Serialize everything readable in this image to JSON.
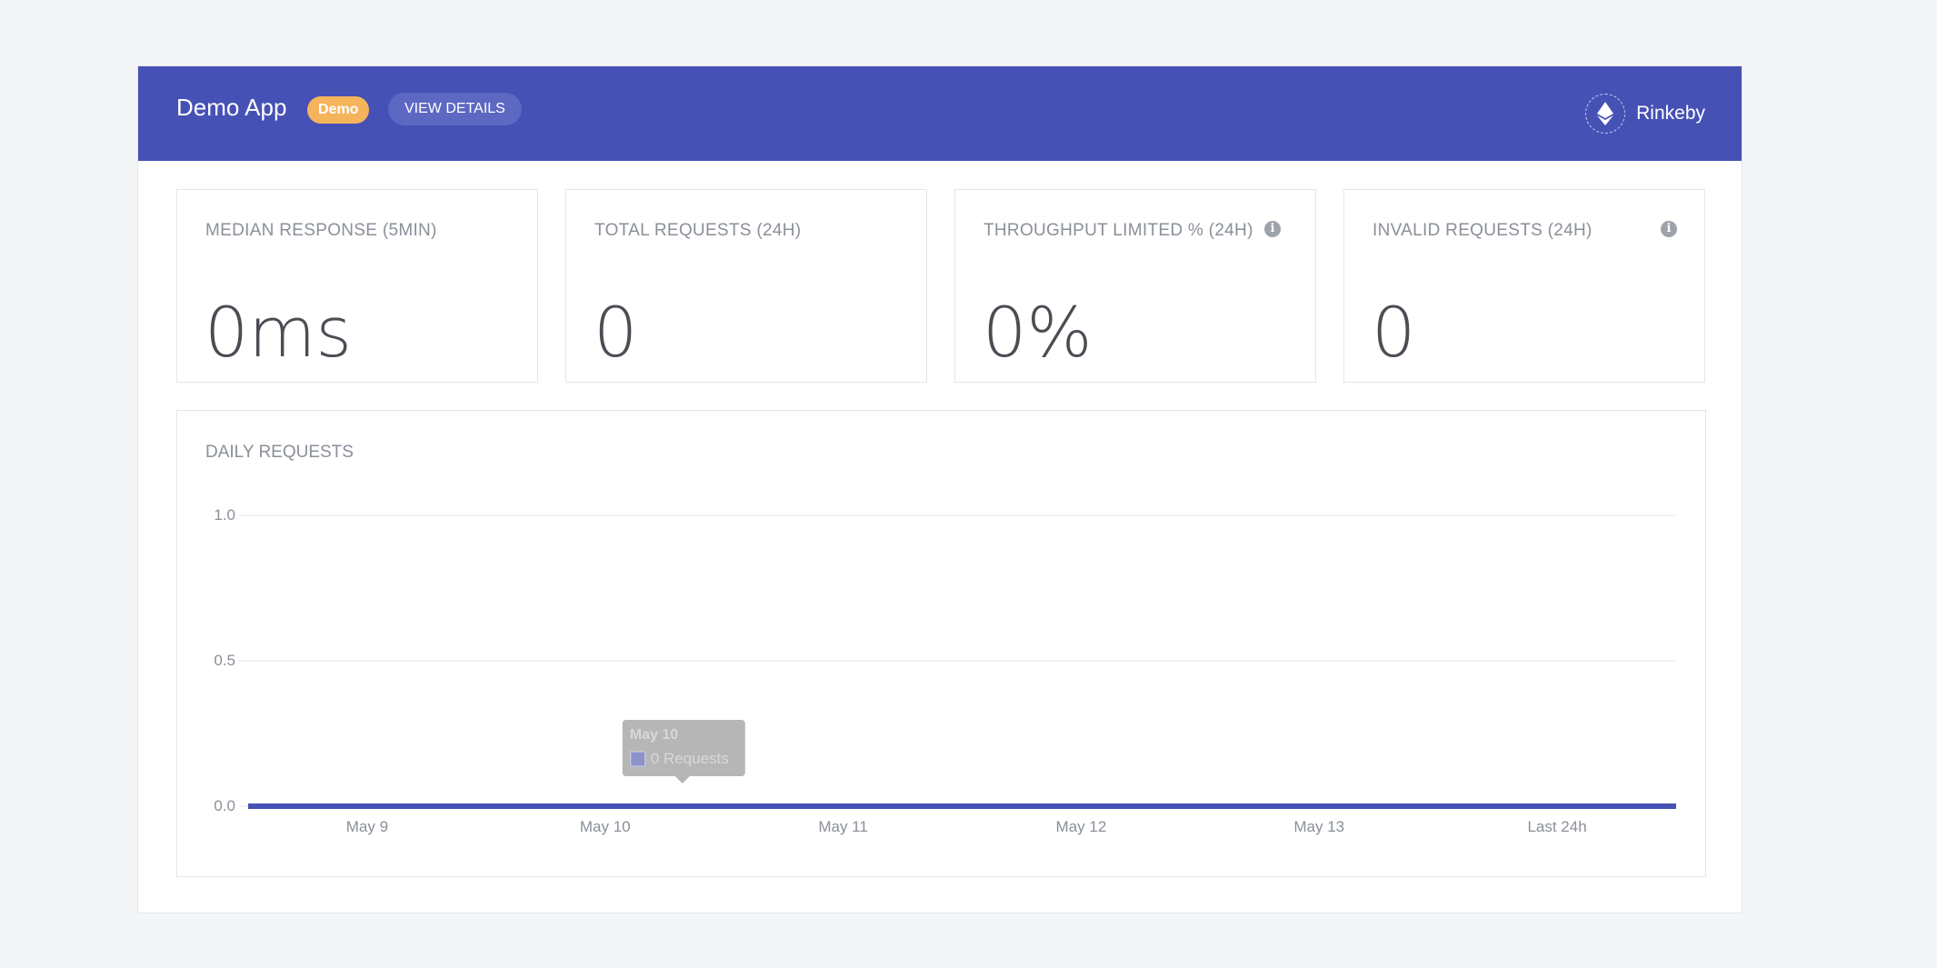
{
  "header": {
    "app_title": "Demo App",
    "badge": "Demo",
    "view_details": "VIEW DETAILS",
    "network": "Rinkeby"
  },
  "stats": [
    {
      "label": "MEDIAN RESPONSE (5MIN)",
      "value": "0ms",
      "info": false
    },
    {
      "label": "TOTAL REQUESTS (24H)",
      "value": "0",
      "info": false
    },
    {
      "label": "THROUGHPUT LIMITED % (24H)",
      "value": "0%",
      "info": true
    },
    {
      "label": "INVALID REQUESTS (24H)",
      "value": "0",
      "info": true
    }
  ],
  "chart_title": "DAILY REQUESTS",
  "tooltip": {
    "title": "May 10",
    "text": "0 Requests"
  },
  "colors": {
    "header": "#4651b5",
    "badge": "#f5b45c",
    "line": "#4651b5"
  },
  "chart_data": {
    "type": "line",
    "title": "DAILY REQUESTS",
    "categories": [
      "May 9",
      "May 10",
      "May 11",
      "May 12",
      "May 13",
      "Last 24h"
    ],
    "series": [
      {
        "values": [
          0,
          0,
          0,
          0,
          0,
          0
        ]
      }
    ],
    "ylim": [
      0,
      1
    ],
    "yticks": [
      0.0,
      0.5,
      1.0
    ],
    "ytick_labels": [
      "0.0",
      "0.5",
      "1.0"
    ],
    "grid": true
  }
}
